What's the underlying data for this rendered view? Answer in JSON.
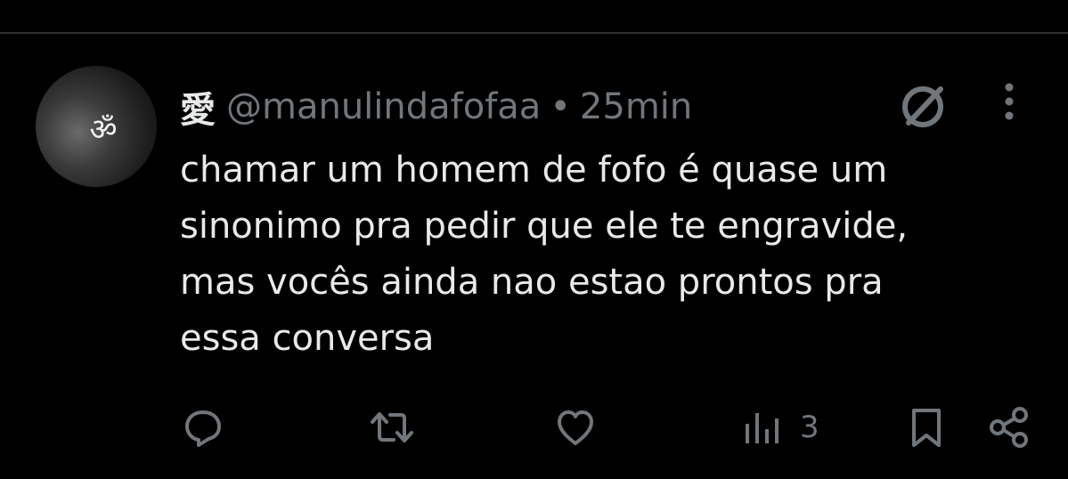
{
  "tweet": {
    "display_name": "愛",
    "handle": "@manulindafofaa",
    "separator": "•",
    "time": "25min",
    "text_lines": [
      "chamar um homem de fofo é quase um",
      "sinonimo pra pedir que ele te engravide,",
      "mas vocês ainda nao estao prontos pra",
      "essa conversa"
    ],
    "avatar_symbol": "ॐ"
  },
  "actions": {
    "views_count": "3"
  },
  "icons": {
    "grok": "grok-icon",
    "more": "more-dots-icon",
    "reply": "reply-icon",
    "retweet": "retweet-icon",
    "like": "like-icon",
    "views": "views-bar-icon",
    "bookmark": "bookmark-icon",
    "share": "share-icon"
  },
  "colors": {
    "background": "#000000",
    "text": "#e7e9ea",
    "secondary": "#71767b",
    "divider": "#2f3336"
  }
}
